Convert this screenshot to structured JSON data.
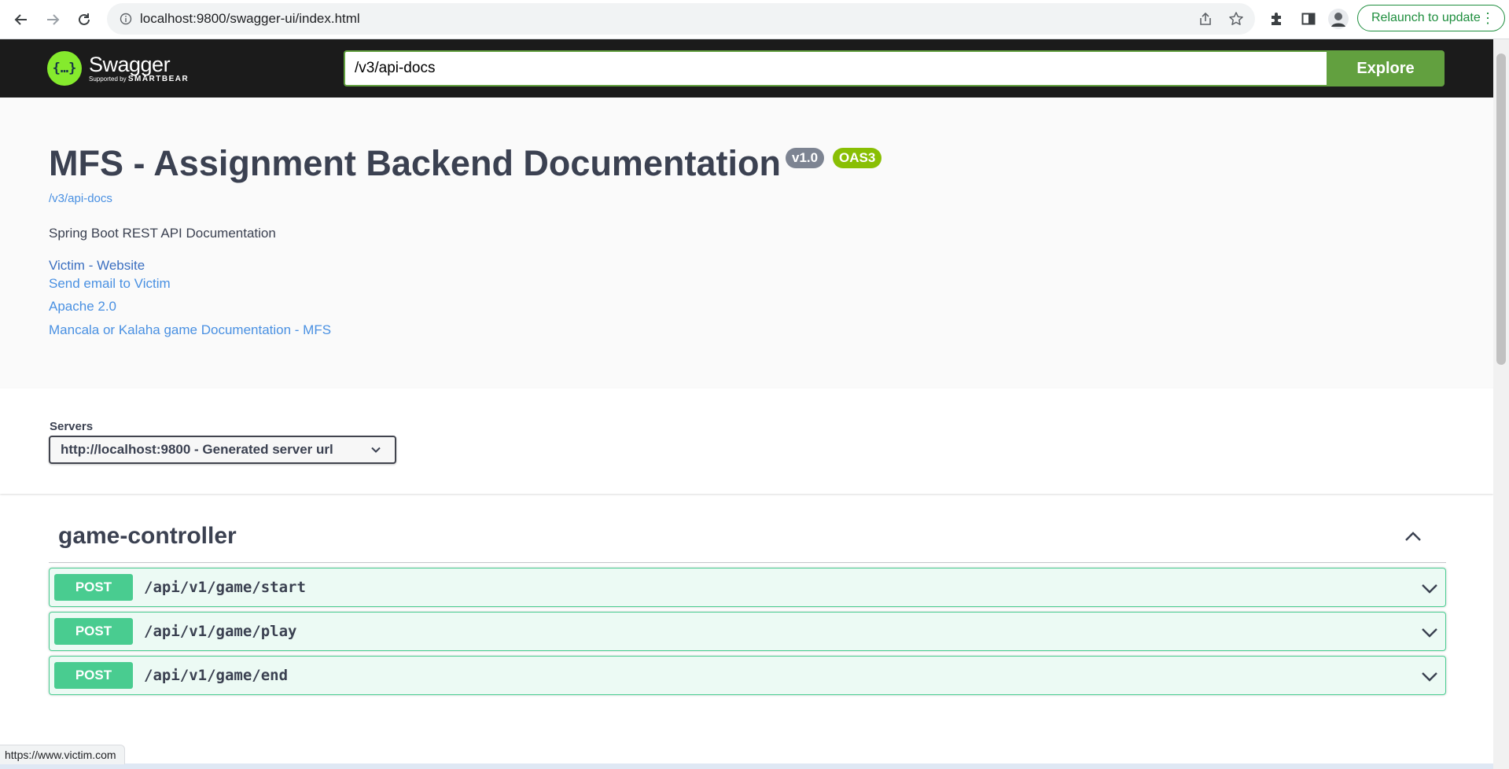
{
  "browser": {
    "url": "localhost:9800/swagger-ui/index.html",
    "relaunch_label": "Relaunch to update"
  },
  "swagger": {
    "logo_text": "Swagger",
    "logo_symbol": "{…}",
    "logo_tagline_prefix": "Supported by",
    "logo_tagline_brand": "SMARTBEAR",
    "spec_url": "/v3/api-docs",
    "explore_label": "Explore"
  },
  "info": {
    "title": "MFS - Assignment Backend Documentation",
    "version": "v1.0",
    "oas": "OAS3",
    "spec_link": "/v3/api-docs",
    "description": "Spring Boot REST API Documentation",
    "contact_website": "Victim - Website",
    "contact_email": "Send email to Victim",
    "license": "Apache 2.0",
    "external_docs": "Mancala or Kalaha game Documentation - MFS"
  },
  "servers": {
    "label": "Servers",
    "selected": "http://localhost:9800 - Generated server url"
  },
  "tag": {
    "name": "game-controller",
    "operations": [
      {
        "method": "POST",
        "path": "/api/v1/game/start"
      },
      {
        "method": "POST",
        "path": "/api/v1/game/play"
      },
      {
        "method": "POST",
        "path": "/api/v1/game/end"
      }
    ]
  },
  "status_bar": {
    "hover_url": "https://www.victim.com"
  },
  "colors": {
    "topbar_bg": "#1b1b1b",
    "explore_green": "#62a03f",
    "post_green": "#49cc90",
    "link_blue": "#4990e2",
    "version_badge": "#7d8492",
    "oas_badge": "#89bf04"
  }
}
